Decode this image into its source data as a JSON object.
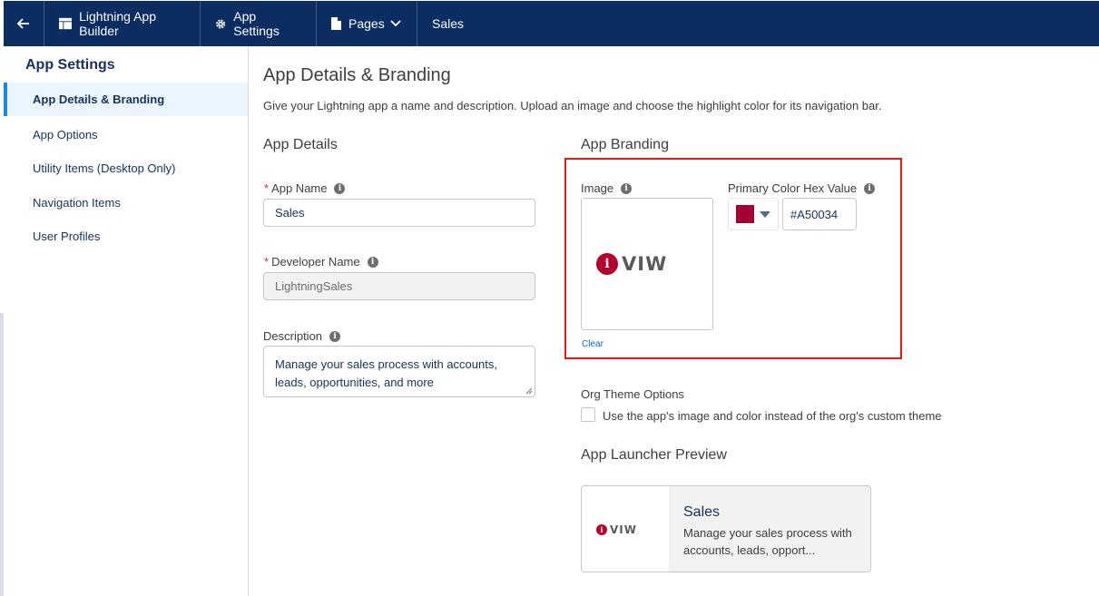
{
  "topbar": {
    "back_icon": "arrow-left-icon",
    "builder_label": "Lightning App Builder",
    "settings_label": "App Settings",
    "pages_label": "Pages",
    "page_name": "Sales"
  },
  "sidebar": {
    "title": "App Settings",
    "items": [
      {
        "label": "App Details & Branding",
        "active": true
      },
      {
        "label": "App Options"
      },
      {
        "label": "Utility Items (Desktop Only)"
      },
      {
        "label": "Navigation Items"
      },
      {
        "label": "User Profiles"
      }
    ]
  },
  "main": {
    "title": "App Details & Branding",
    "subtitle": "Give your Lightning app a name and description. Upload an image and choose the highlight color for its navigation bar.",
    "details": {
      "heading": "App Details",
      "required_mark": "*",
      "app_name_label": "App Name",
      "app_name_value": "Sales",
      "dev_name_label": "Developer Name",
      "dev_name_value": "LightningSales",
      "description_label": "Description",
      "description_value": "Manage your sales process with accounts, leads, opportunities, and more"
    },
    "branding": {
      "heading": "App Branding",
      "image_label": "Image",
      "logo_text": "VIW",
      "clear_label": "Clear",
      "color_label": "Primary Color Hex Value",
      "color_value": "#A50034",
      "org_theme_label": "Org Theme Options",
      "org_theme_checkbox_label": "Use the app's image and color instead of the org's custom theme",
      "org_theme_checked": false
    },
    "preview": {
      "heading": "App Launcher Preview",
      "logo_text": "VIW",
      "title": "Sales",
      "description": "Manage your sales process with accounts, leads, opport..."
    }
  },
  "colors": {
    "topbar": "#0b2d61",
    "brand": "#A50034",
    "highlight_box": "#e0161b",
    "active_item_bg": "#eaf5fe",
    "link": "#006dcc"
  }
}
